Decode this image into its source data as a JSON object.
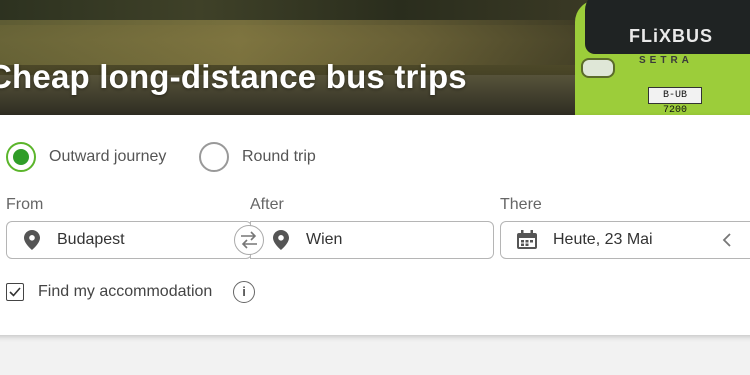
{
  "hero": {
    "headline": "Cheap long-distance bus trips",
    "bus_brand": "FLiXBUS",
    "bus_model": "SETRA",
    "plate": "B-UB 7200"
  },
  "trip_type": {
    "options": [
      {
        "label": "Outward journey",
        "selected": true
      },
      {
        "label": "Round trip",
        "selected": false
      }
    ]
  },
  "search": {
    "from_label": "From",
    "from_value": "Budapest",
    "to_label": "After",
    "to_value": "Wien",
    "date_label": "There",
    "date_value": "Heute, 23 Mai"
  },
  "accommodation": {
    "label": "Find my accommodation",
    "checked": true
  },
  "colors": {
    "accent_green": "#2f9d28",
    "bus_green": "#9ccd3a"
  }
}
